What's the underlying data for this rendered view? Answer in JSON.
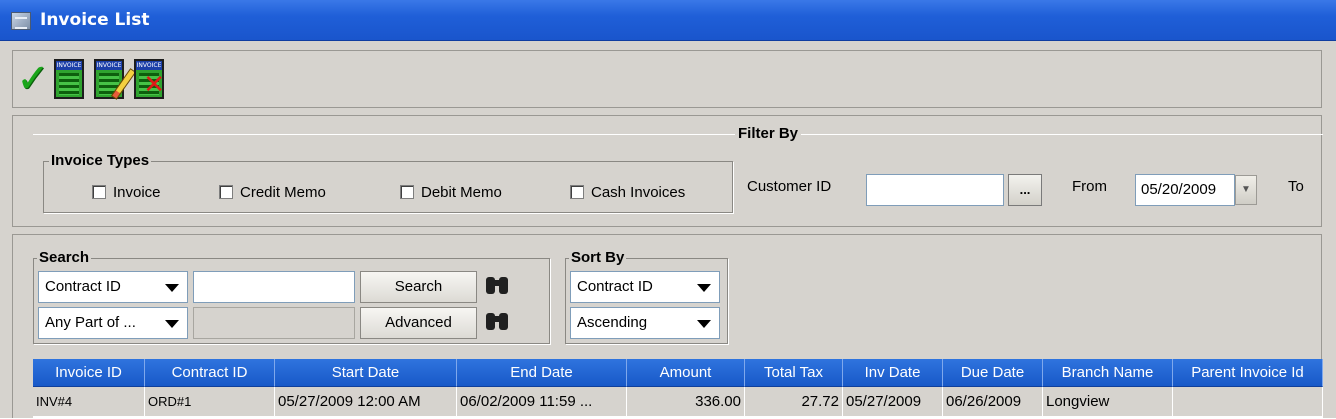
{
  "window": {
    "title": "Invoice List"
  },
  "toolbar": {
    "buttons": [
      {
        "name": "accept",
        "icon": "checkmark-icon"
      },
      {
        "name": "invoice",
        "icon": "invoice-icon",
        "badge": "INVOICE"
      },
      {
        "name": "edit-invoice",
        "icon": "invoice-edit-icon",
        "badge": "INVOICE"
      },
      {
        "name": "cancel-invoice",
        "icon": "invoice-cancel-icon",
        "badge": "INVOICE"
      }
    ]
  },
  "filter": {
    "title": "Filter By",
    "invoice_types": {
      "title": "Invoice Types",
      "options": [
        "Invoice",
        "Credit Memo",
        "Debit Memo",
        "Cash Invoices"
      ]
    },
    "customer_label": "Customer ID",
    "customer_value": "",
    "lookup_label": "...",
    "from_label": "From",
    "from_value": "05/20/2009",
    "to_label": "To"
  },
  "search": {
    "title": "Search",
    "field": "Contract ID",
    "mode": "Any Part of ...",
    "query": "",
    "search_button": "Search",
    "advanced_button": "Advanced"
  },
  "sort": {
    "title": "Sort By",
    "field": "Contract ID",
    "order": "Ascending"
  },
  "table": {
    "columns": [
      "Invoice ID",
      "Contract ID",
      "Start Date",
      "End Date",
      "Amount",
      "Total Tax",
      "Inv Date",
      "Due Date",
      "Branch Name",
      "Parent Invoice Id"
    ],
    "rows": [
      [
        "INV#4",
        "ORD#1",
        "05/27/2009 12:00 AM",
        "06/02/2009 11:59 ...",
        "336.00",
        "27.72",
        "05/27/2009",
        "06/26/2009",
        "Longview",
        ""
      ]
    ]
  },
  "colors": {
    "titlebar": "#1f5fd8",
    "header": "#1c64d4",
    "panel": "#d6d3ce"
  }
}
